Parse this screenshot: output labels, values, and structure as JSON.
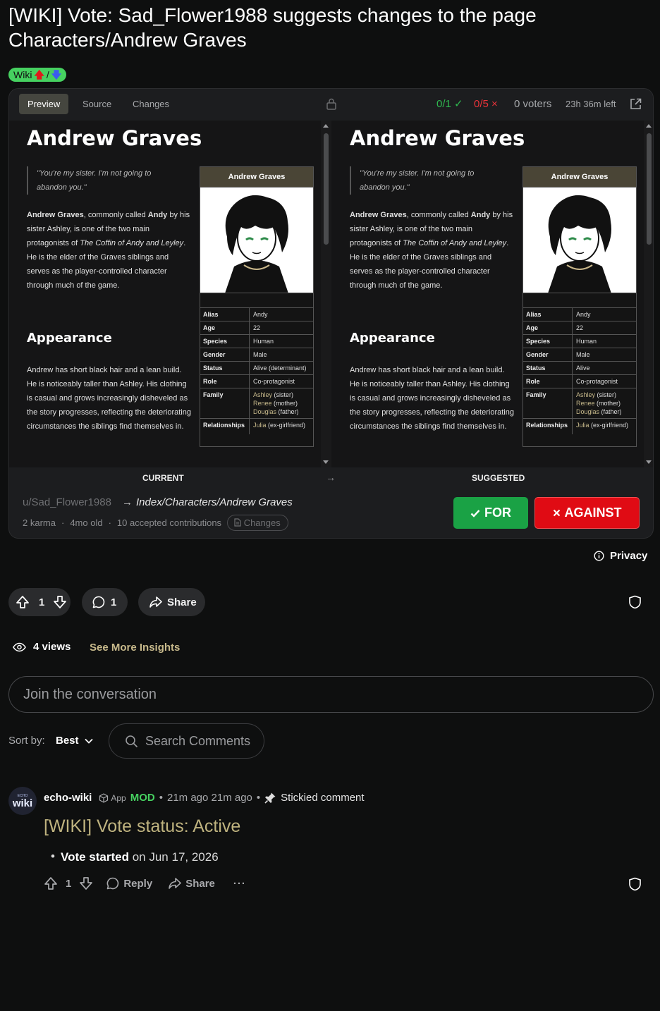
{
  "post": {
    "title": "[WIKI] Vote: Sad_Flower1988 suggests changes to the page Characters/Andrew Graves",
    "flair_text": "Wiki",
    "flair_slash": "/",
    "flair_up": "🡅",
    "flair_down": "🡇"
  },
  "vote_card": {
    "tabs": [
      {
        "label": "Preview",
        "active": true
      },
      {
        "label": "Source",
        "active": false
      },
      {
        "label": "Changes",
        "active": false
      }
    ],
    "for_count": "0/1",
    "for_check": "✓",
    "against_count": "0/5",
    "against_x": "×",
    "voters": "0 voters",
    "time_left": "23h 36m left",
    "current_label": "CURRENT",
    "arrow": "→",
    "suggested_label": "SUGGESTED",
    "username": "u/Sad_Flower1988",
    "path_arrow": "→",
    "path": "Index/Characters/Andrew Graves",
    "karma": "2 karma",
    "dot": "·",
    "age": "4mo old",
    "contributions": "10 accepted contributions",
    "changes_pill": "Changes",
    "for_button": "FOR",
    "against_button": "AGAINST"
  },
  "article": {
    "heading": "Andrew Graves",
    "quote": "\"You're my sister. I'm not going to abandon you.\"",
    "intro_name": "Andrew Graves",
    "intro_text1": ", commonly called ",
    "intro_nick": "Andy",
    "intro_text2": " by his sister Ashley, is one of the two main protagonists of ",
    "intro_game": "The Coffin of Andy and Leyley",
    "intro_text3": ". He is the elder of the Graves siblings and serves as the player-controlled character through much of the game.",
    "appearance_heading": "Appearance",
    "appearance_text": "Andrew has short black hair and a lean build. He is noticeably taller than Ashley. His clothing is casual and grows increasingly disheveled as the story progresses, reflecting the deteriorating circumstances the siblings find themselves in."
  },
  "infobox_current": {
    "title": "Andrew Graves",
    "rows": {
      "alias_k": "Alias",
      "alias_v": "Andy",
      "age_k": "Age",
      "age_v": "22",
      "species_k": "Species",
      "species_v": "Human",
      "gender_k": "Gender",
      "gender_v": "Male",
      "status_k": "Status",
      "status_v": "Alive (determinant)",
      "role_k": "Role",
      "role_v": "Co-protagonist",
      "family_k": "Family",
      "sister": "Ashley",
      "sister_rel": " (sister)",
      "mother": "Renee",
      "mother_rel": " (mother)",
      "father": "Douglas",
      "father_rel": " (father)",
      "rel_k": "Relationships",
      "rel_name": "Julia",
      "rel_note": " (ex-girlfriend)"
    }
  },
  "infobox_suggested": {
    "title": "Andrew Graves",
    "rows": {
      "alias_k": "Alias",
      "alias_v": "Andy",
      "age_k": "Age",
      "age_v": "22",
      "species_k": "Species",
      "species_v": "Human",
      "gender_k": "Gender",
      "gender_v": "Male",
      "status_k": "Status",
      "status_v": "Alive",
      "role_k": "Role",
      "role_v": "Co-protagonist",
      "family_k": "Family",
      "sister": "Ashley",
      "sister_rel": " (sister)",
      "mother": "Renee",
      "mother_rel": " (mother)",
      "father": "Douglas",
      "father_rel": " (father)",
      "rel_k": "Relationships",
      "rel_name": "Julia",
      "rel_note": " (ex-girlfriend)"
    }
  },
  "footer": {
    "privacy": "Privacy",
    "upvotes": "1",
    "comments": "1",
    "share": "Share",
    "views": "4 views",
    "insights": "See More Insights",
    "join_placeholder": "Join the conversation",
    "sort_label": "Sort by:",
    "sort_value": "Best",
    "search_placeholder": "Search Comments"
  },
  "comment": {
    "avatar_top": "ECHO",
    "avatar_bottom": "wiki",
    "author": "echo-wiki",
    "app_label": "App",
    "mod_label": "MOD",
    "sep": "•",
    "time": "21m ago 21m ago",
    "stickied": "Stickied comment",
    "title": "[WIKI] Vote status: Active",
    "bullet_bold": "Vote started",
    "bullet_rest": " on Jun 17, 2026",
    "score": "1",
    "reply": "Reply",
    "share": "Share",
    "more": "···"
  },
  "colors": {
    "accent_gold": "#c7b98b",
    "for_green": "#1aa245",
    "against_red": "#e00b14",
    "flair_green": "#46d160"
  }
}
